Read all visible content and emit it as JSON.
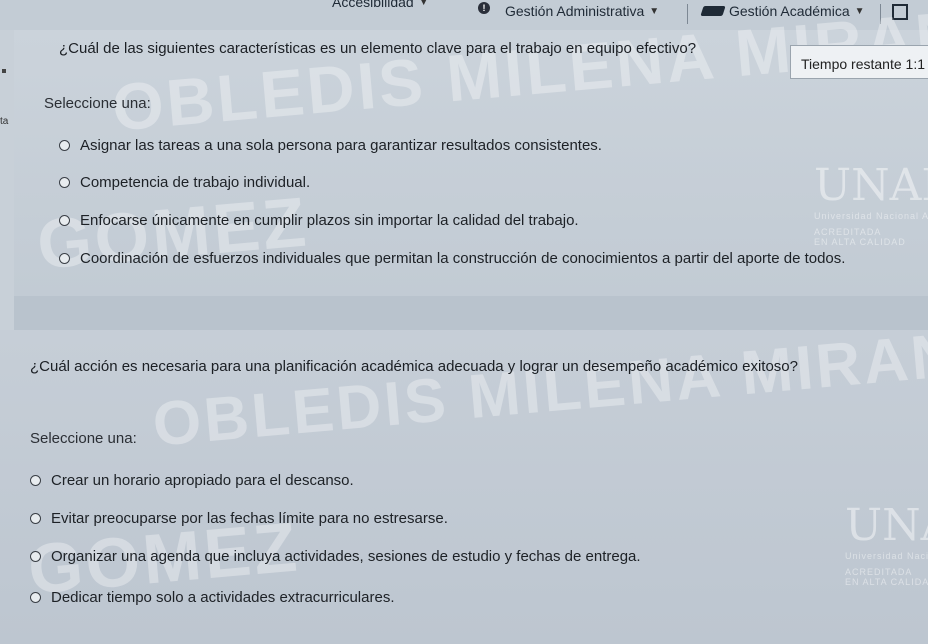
{
  "topbar": {
    "accessibility_label": "Accesibilidad",
    "admin_label": "Gestión Administrativa",
    "academic_label": "Gestión Académica"
  },
  "sidebar": {
    "fragment_label": "ta"
  },
  "timer": {
    "label": "Tiempo restante 1:1"
  },
  "question1": {
    "text": "¿Cuál de las siguientes características es un elemento clave para el trabajo en equipo efectivo?",
    "select_label": "Seleccione una:",
    "options": [
      "Asignar las tareas a una sola persona para garantizar resultados consistentes.",
      "Competencia de trabajo individual.",
      "Enfocarse únicamente en cumplir plazos sin importar la calidad del trabajo.",
      "Coordinación de esfuerzos individuales que permitan la construcción de conocimientos a partir del aporte de todos."
    ]
  },
  "question2": {
    "text": "¿Cuál acción es necesaria para una planificación académica adecuada y lograr un desempeño académico exitoso?",
    "select_label": "Seleccione una:",
    "options": [
      "Crear un horario apropiado para el descanso.",
      "Evitar preocuparse por las fechas límite para no estresarse.",
      "Organizar una agenda que incluya actividades, sesiones de estudio y fechas de entrega.",
      "Dedicar tiempo solo a actividades extracurriculares."
    ]
  },
  "watermark": {
    "q1_line1": "OBLEDIS MILENA MIRAN",
    "q1_line2": "GOMEZ",
    "q2_line1": "OBLEDIS MILENA MIRANDA",
    "q2_line2": "GOMEZ"
  },
  "logo": {
    "mark": "UNAD",
    "university": "Universidad Nacional Abierta y a Distancia",
    "accreditation": "ACREDITADA",
    "quality": "EN ALTA CALIDAD"
  }
}
